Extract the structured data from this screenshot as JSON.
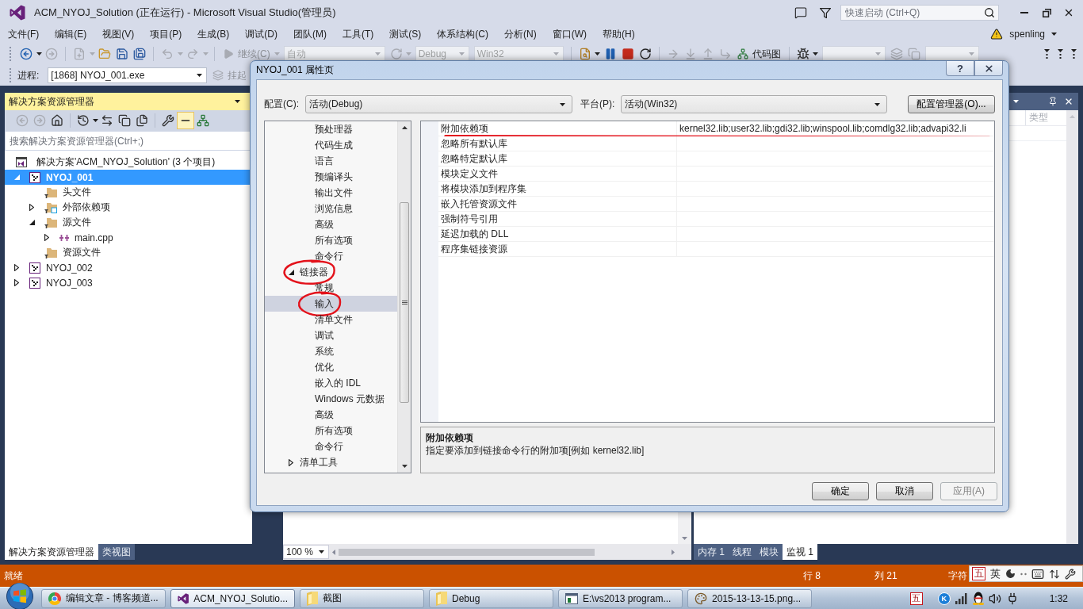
{
  "window": {
    "title": "ACM_NYOJ_Solution (正在运行) - Microsoft Visual Studio(管理员)",
    "quick_launch": {
      "placeholder": "快速启动 (Ctrl+Q)"
    }
  },
  "menu": {
    "items": [
      "文件(F)",
      "编辑(E)",
      "视图(V)",
      "项目(P)",
      "生成(B)",
      "调试(D)",
      "团队(M)",
      "工具(T)",
      "测试(S)",
      "体系结构(C)",
      "分析(N)",
      "窗口(W)",
      "帮助(H)"
    ],
    "user": "spenling"
  },
  "toolbar": [
    {
      "kind": "icon",
      "disabled": false,
      "menu": true
    },
    {
      "kind": "icon",
      "disabled": true
    },
    {
      "kind": "separator"
    },
    {
      "kind": "icon",
      "disabled": true,
      "menu": true
    },
    {
      "kind": "icon",
      "disabled": false
    },
    {
      "kind": "icon",
      "disabled": false
    },
    {
      "kind": "icon",
      "disabled": false
    },
    {
      "kind": "separator"
    },
    {
      "kind": "icon",
      "disabled": true,
      "menu": true
    },
    {
      "kind": "icon",
      "disabled": true,
      "menu": true
    },
    {
      "kind": "separator"
    },
    {
      "kind": "button",
      "label": "继续(C)",
      "disabled": true,
      "menu": true
    },
    {
      "kind": "combo",
      "value": "自动",
      "disabled": true
    },
    {
      "kind": "icon",
      "disabled": true,
      "menu": true
    },
    {
      "kind": "combo",
      "value": "Debug",
      "disabled": true
    },
    {
      "kind": "combo",
      "value": "Win32",
      "disabled": true
    },
    {
      "kind": "separator"
    },
    {
      "kind": "icon",
      "disabled": false,
      "menu": true
    },
    {
      "kind": "icon",
      "disabled": false
    },
    {
      "kind": "icon",
      "disabled": false
    },
    {
      "kind": "icon",
      "disabled": false
    },
    {
      "kind": "separator"
    },
    {
      "kind": "icon",
      "disabled": true
    },
    {
      "kind": "icon",
      "disabled": true
    },
    {
      "kind": "icon",
      "disabled": true
    },
    {
      "kind": "icon",
      "disabled": true
    },
    {
      "kind": "button",
      "label": "代码图",
      "disabled": false
    },
    {
      "kind": "separator"
    },
    {
      "kind": "icon",
      "disabled": false,
      "menu": true
    },
    {
      "kind": "combo",
      "disabled": true
    },
    {
      "kind": "icon",
      "disabled": true
    },
    {
      "kind": "icon",
      "disabled": true
    },
    {
      "kind": "combo",
      "disabled": true
    }
  ],
  "debug_toolbar": {
    "label": "进程:",
    "process": "[1868] NYOJ_001.exe",
    "suspend": {
      "label": "挂起",
      "disabled": true
    }
  },
  "solution_explorer": {
    "title": "解决方案资源管理器",
    "active": true,
    "tools": [
      {
        "kind": "icon",
        "disabled": true,
        "on": false
      },
      {
        "kind": "icon",
        "disabled": true,
        "on": false
      },
      {
        "kind": "icon",
        "disabled": false,
        "on": false
      },
      {
        "kind": "separator"
      },
      {
        "kind": "icon",
        "disabled": false,
        "on": false,
        "menu": true
      },
      {
        "kind": "icon",
        "disabled": false,
        "on": false
      },
      {
        "kind": "icon",
        "disabled": false,
        "on": false
      },
      {
        "kind": "icon",
        "disabled": false,
        "on": false
      },
      {
        "kind": "separator"
      },
      {
        "kind": "icon",
        "disabled": false,
        "on": false
      },
      {
        "kind": "icon",
        "disabled": false,
        "on": true
      },
      {
        "kind": "icon",
        "disabled": false,
        "on": false
      }
    ],
    "search": {
      "placeholder": "搜索解决方案资源管理器(Ctrl+;)"
    },
    "solution": {
      "label": "解决方案'ACM_NYOJ_Solution' (3 个项目)",
      "selected": false
    },
    "projects": [
      {
        "label": "NYOJ_001",
        "kind": "project",
        "selected": true,
        "startup": true,
        "expanded": true,
        "children": [
          {
            "label": "头文件",
            "kind": "folder",
            "selected": false
          },
          {
            "label": "外部依赖项",
            "kind": "dependencies",
            "selected": false,
            "expanded": false
          },
          {
            "label": "源文件",
            "kind": "folder",
            "selected": false,
            "expanded": true,
            "children": [
              {
                "label": "main.cpp",
                "kind": "file",
                "selected": false,
                "expanded": false
              }
            ]
          },
          {
            "label": "资源文件",
            "kind": "folder",
            "selected": false
          }
        ]
      },
      {
        "label": "NYOJ_002",
        "kind": "project",
        "selected": false,
        "startup": false,
        "expanded": false
      },
      {
        "label": "NYOJ_003",
        "kind": "project",
        "selected": false,
        "startup": false,
        "expanded": false
      }
    ],
    "tabs": [
      {
        "label": "解决方案资源管理器",
        "selected": true
      },
      {
        "label": "类视图",
        "selected": false
      }
    ]
  },
  "editor": {
    "zoom": "100 %"
  },
  "watch_panel": {
    "active": false,
    "column": "类型",
    "tabs": [
      {
        "label": "内存 1",
        "selected": false
      },
      {
        "label": "线程",
        "selected": false
      },
      {
        "label": "模块",
        "selected": false
      },
      {
        "label": "监视 1",
        "selected": true
      }
    ]
  },
  "dialog": {
    "title": "NYOJ_001 属性页",
    "help": "?",
    "config": {
      "label": "配置(C):",
      "value": "活动(Debug)"
    },
    "platform": {
      "label": "平台(P):",
      "value": "活动(Win32)"
    },
    "manager_button": "配置管理器(O)...",
    "tree": [
      {
        "children": [
          {
            "label": "预处理器",
            "selected": false,
            "circled": false
          },
          {
            "label": "代码生成",
            "selected": false,
            "circled": false
          },
          {
            "label": "语言",
            "selected": false,
            "circled": false
          },
          {
            "label": "预编译头",
            "selected": false,
            "circled": false
          },
          {
            "label": "输出文件",
            "selected": false,
            "circled": false
          },
          {
            "label": "浏览信息",
            "selected": false,
            "circled": false
          },
          {
            "label": "高级",
            "selected": false,
            "circled": false
          },
          {
            "label": "所有选项",
            "selected": false,
            "circled": false
          },
          {
            "label": "命令行",
            "selected": false,
            "circled": false
          }
        ]
      },
      {
        "label": "链接器",
        "expanded": true,
        "selected": false,
        "circled": true,
        "children": [
          {
            "label": "常规",
            "selected": false,
            "circled": false
          },
          {
            "label": "输入",
            "selected": true,
            "circled": true
          },
          {
            "label": "清单文件",
            "selected": false,
            "circled": false
          },
          {
            "label": "调试",
            "selected": false,
            "circled": false
          },
          {
            "label": "系统",
            "selected": false,
            "circled": false
          },
          {
            "label": "优化",
            "selected": false,
            "circled": false
          },
          {
            "label": "嵌入的 IDL",
            "selected": false,
            "circled": false
          },
          {
            "label": "Windows 元数据",
            "selected": false,
            "circled": false
          },
          {
            "label": "高级",
            "selected": false,
            "circled": false
          },
          {
            "label": "所有选项",
            "selected": false,
            "circled": false
          },
          {
            "label": "命令行",
            "selected": false,
            "circled": false
          }
        ]
      },
      {
        "label": "清单工具",
        "expanded": false,
        "selected": false,
        "circled": false
      }
    ],
    "properties": [
      {
        "name": "附加依赖项",
        "value": "kernel32.lib;user32.lib;gdi32.lib;winspool.lib;comdlg32.lib;advapi32.li",
        "underlined": true
      },
      {
        "name": "忽略所有默认库",
        "underlined": false
      },
      {
        "name": "忽略特定默认库",
        "underlined": false
      },
      {
        "name": "模块定义文件",
        "underlined": false
      },
      {
        "name": "将模块添加到程序集",
        "underlined": false
      },
      {
        "name": "嵌入托管资源文件",
        "underlined": false
      },
      {
        "name": "强制符号引用",
        "underlined": false
      },
      {
        "name": "延迟加载的 DLL",
        "underlined": false
      },
      {
        "name": "程序集链接资源",
        "underlined": false
      }
    ],
    "description": {
      "title": "附加依赖项",
      "text": "指定要添加到链接命令行的附加项[例如 kernel32.lib]"
    },
    "buttons": [
      {
        "label": "确定",
        "disabled": false
      },
      {
        "label": "取消",
        "disabled": false
      },
      {
        "label": "应用(A)",
        "disabled": true
      }
    ]
  },
  "status_bar": {
    "text": "就绪",
    "line": "行 8",
    "column": "列 21",
    "char": "字符"
  },
  "ime_bar": {
    "mode": "五",
    "language": "英"
  },
  "taskbar": {
    "buttons": [
      {
        "label": "编辑文章 - 博客频道...",
        "kind": "browser",
        "selected": false
      },
      {
        "label": "ACM_NYOJ_Solutio...",
        "kind": "studio",
        "selected": true
      },
      {
        "label": "截图",
        "kind": "folder",
        "selected": false
      },
      {
        "label": "Debug",
        "kind": "folder",
        "selected": false
      },
      {
        "label": "E:\\vs2013 program...",
        "kind": "console",
        "selected": false
      },
      {
        "label": "2015-13-13-15.png...",
        "kind": "paint",
        "selected": false
      }
    ],
    "tray": {
      "ime": "五",
      "badge": "K",
      "time": "1:32"
    }
  }
}
